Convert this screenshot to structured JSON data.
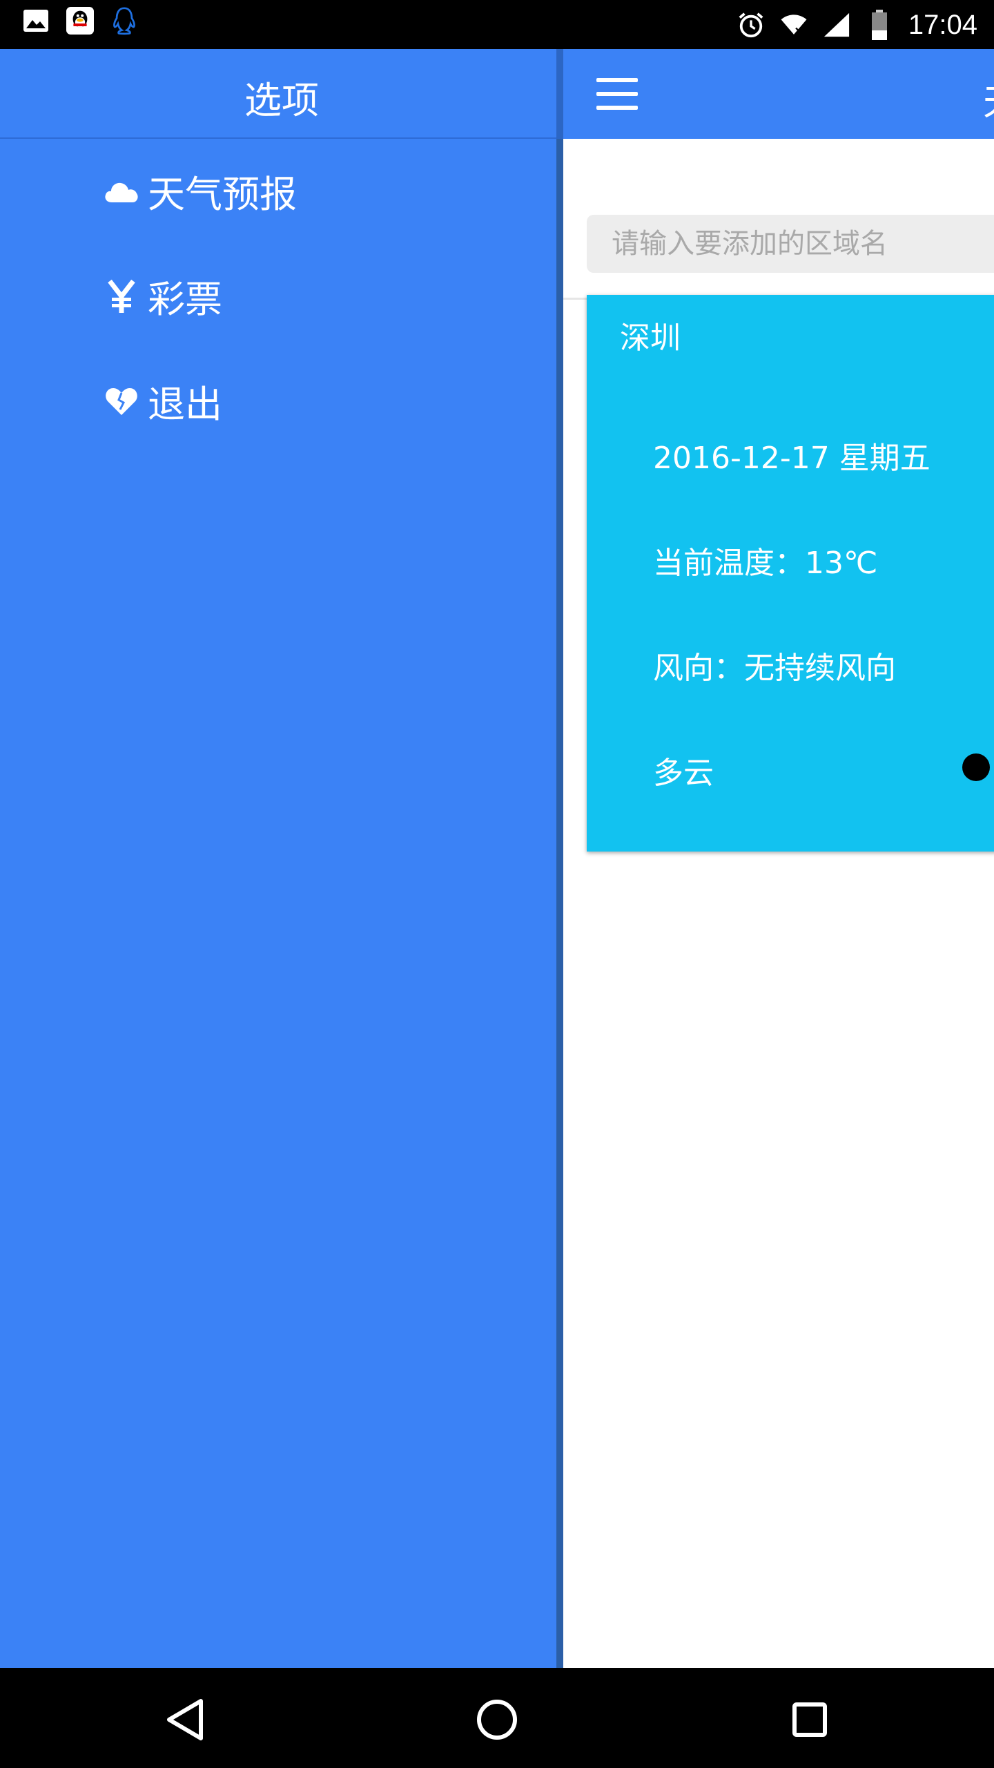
{
  "status_bar": {
    "time": "17:04",
    "icons": [
      "image-icon",
      "qq-icon",
      "qq-outline-icon",
      "alarm-icon",
      "wifi-icon",
      "signal-icon",
      "battery-icon"
    ]
  },
  "drawer": {
    "title": "选项",
    "items": [
      {
        "icon": "cloud-icon",
        "label": "天气预报"
      },
      {
        "icon": "yen-icon",
        "label": "彩票"
      },
      {
        "icon": "broken-heart-icon",
        "label": "退出"
      }
    ]
  },
  "main": {
    "header_title_peek": "天",
    "search": {
      "placeholder": "请输入要添加的区域名"
    },
    "card": {
      "city": "深圳",
      "date": "2016-12-17 星期五",
      "temperature": "当前温度：13℃",
      "wind": "风向：无持续风向",
      "condition": "多云"
    }
  },
  "colors": {
    "drawer_bg": "#3b82f6",
    "card_bg": "#12c2f0"
  }
}
